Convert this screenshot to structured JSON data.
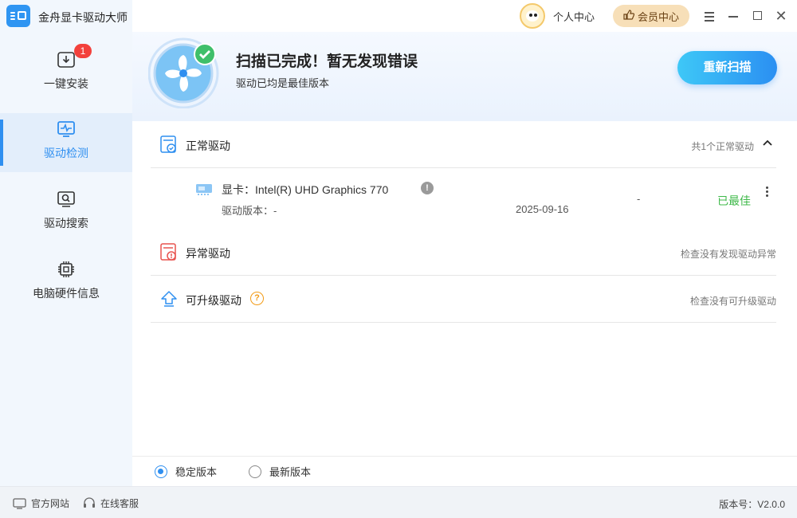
{
  "app": {
    "title": "金舟显卡驱动大师"
  },
  "header": {
    "user_center": "个人中心",
    "vip": "会员中心"
  },
  "sidebar": {
    "items": [
      {
        "label": "一键安装",
        "badge": "1"
      },
      {
        "label": "驱动检测"
      },
      {
        "label": "驱动搜索"
      },
      {
        "label": "电脑硬件信息"
      }
    ]
  },
  "banner": {
    "title": "扫描已完成！暂无发现错误",
    "subtitle": "驱动已均是最佳版本",
    "rescan_label": "重新扫描"
  },
  "sections": {
    "normal": {
      "title": "正常驱动",
      "note": "共1个正常驱动"
    },
    "abnormal": {
      "title": "异常驱动",
      "note": "检查没有发现驱动异常"
    },
    "upgradable": {
      "title": "可升级驱动",
      "note": "检查没有可升级驱动"
    }
  },
  "driver": {
    "name": "显卡：Intel(R) UHD Graphics 770",
    "version": "驱动版本：-",
    "date": "2025-09-16",
    "dash": "-",
    "status": "已最佳"
  },
  "version_choice": {
    "stable": "稳定版本",
    "latest": "最新版本",
    "selected": "stable"
  },
  "footer": {
    "website": "官方网站",
    "support": "在线客服",
    "version": "版本号：V2.0.0"
  },
  "colors": {
    "accent": "#2f8ff0",
    "success": "#3fb94a",
    "badge": "#f3413c",
    "warning": "#f29b16",
    "error": "#e8534f"
  }
}
